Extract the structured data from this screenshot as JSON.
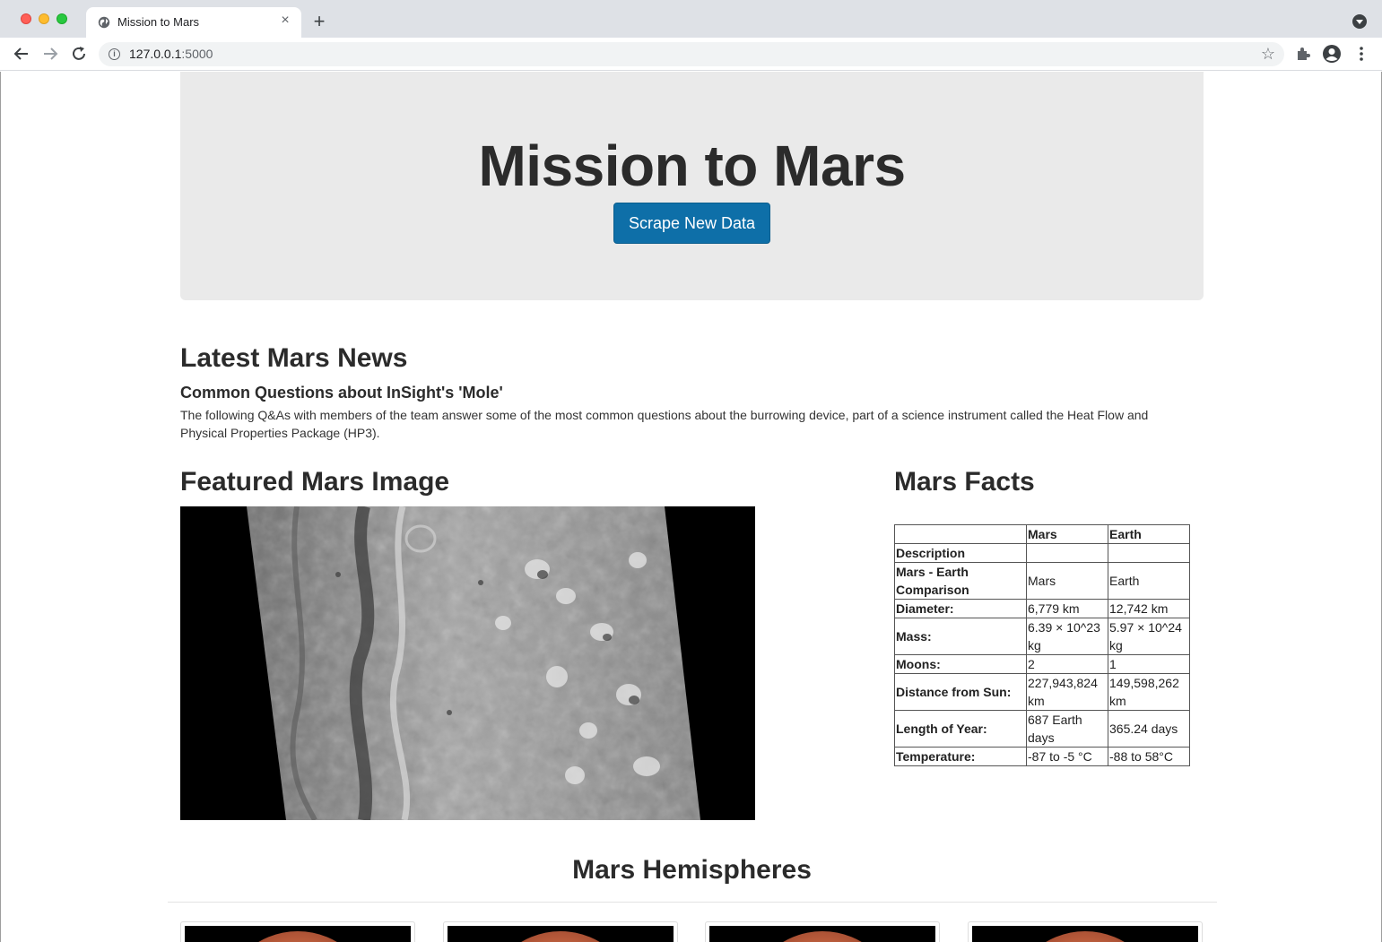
{
  "browser": {
    "tab_title": "Mission to Mars",
    "tab_close_glyph": "×",
    "new_tab_glyph": "+",
    "url_host": "127.0.0.1",
    "url_port": ":5000",
    "icons": [
      "globe-icon",
      "back-icon",
      "forward-icon",
      "reload-icon",
      "info-icon",
      "star-icon",
      "puzzle-icon",
      "account-icon",
      "more-vert-icon",
      "tab-search-icon"
    ]
  },
  "hero": {
    "title": "Mission to Mars",
    "button_label": "Scrape New Data",
    "button_color": "#0e6fa8"
  },
  "news": {
    "heading": "Latest Mars News",
    "title": "Common Questions about InSight's 'Mole'",
    "teaser": "The following Q&As with members of the team answer some of the most common questions about the burrowing device, part of a science instrument called the Heat Flow and Physical Properties Package (HP3)."
  },
  "featured": {
    "heading": "Featured Mars Image"
  },
  "facts": {
    "heading": "Mars Facts",
    "columns": [
      "",
      "Mars",
      "Earth"
    ],
    "rows": [
      {
        "label": "Description",
        "mars": "",
        "earth": ""
      },
      {
        "label": "Mars - Earth Comparison",
        "mars": "Mars",
        "earth": "Earth"
      },
      {
        "label": "Diameter:",
        "mars": "6,779 km",
        "earth": "12,742 km"
      },
      {
        "label": "Mass:",
        "mars": "6.39 × 10^23 kg",
        "earth": "5.97 × 10^24 kg"
      },
      {
        "label": "Moons:",
        "mars": "2",
        "earth": "1"
      },
      {
        "label": "Distance from Sun:",
        "mars": "227,943,824 km",
        "earth": "149,598,262 km"
      },
      {
        "label": "Length of Year:",
        "mars": "687 Earth days",
        "earth": "365.24 days"
      },
      {
        "label": "Temperature:",
        "mars": "-87 to -5 °C",
        "earth": "-88 to 58°C"
      }
    ]
  },
  "hemispheres": {
    "heading": "Mars Hemispheres",
    "card_count": 4
  }
}
